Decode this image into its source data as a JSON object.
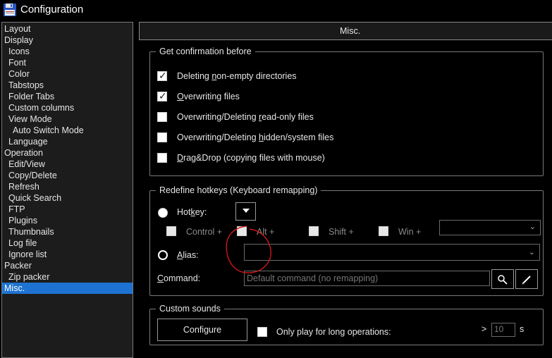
{
  "window": {
    "title": "Configuration",
    "icon": "floppy-disk-icon"
  },
  "sidebar": {
    "items": [
      {
        "label": "Layout",
        "indent": 0
      },
      {
        "label": "Display",
        "indent": 0
      },
      {
        "label": "Icons",
        "indent": 1
      },
      {
        "label": "Font",
        "indent": 1
      },
      {
        "label": "Color",
        "indent": 1
      },
      {
        "label": "Tabstops",
        "indent": 1
      },
      {
        "label": "Folder Tabs",
        "indent": 1
      },
      {
        "label": "Custom columns",
        "indent": 1
      },
      {
        "label": "View Mode",
        "indent": 1
      },
      {
        "label": "Auto Switch Mode",
        "indent": 2
      },
      {
        "label": "Language",
        "indent": 1
      },
      {
        "label": "Operation",
        "indent": 0
      },
      {
        "label": "Edit/View",
        "indent": 1
      },
      {
        "label": "Copy/Delete",
        "indent": 1
      },
      {
        "label": "Refresh",
        "indent": 1
      },
      {
        "label": "Quick Search",
        "indent": 1
      },
      {
        "label": "FTP",
        "indent": 1
      },
      {
        "label": "Plugins",
        "indent": 1
      },
      {
        "label": "Thumbnails",
        "indent": 1
      },
      {
        "label": "Log file",
        "indent": 1
      },
      {
        "label": "Ignore list",
        "indent": 1
      },
      {
        "label": "Packer",
        "indent": 0
      },
      {
        "label": "Zip packer",
        "indent": 1
      },
      {
        "label": "Misc.",
        "indent": 0,
        "selected": true
      }
    ]
  },
  "panel": {
    "title": "Misc."
  },
  "confirm": {
    "legend": "Get confirmation before",
    "items": [
      {
        "pre": "Deleting ",
        "u": "n",
        "post": "on-empty directories",
        "checked": true
      },
      {
        "pre": "",
        "u": "O",
        "post": "verwriting files",
        "checked": true
      },
      {
        "pre": "Overwriting/Deleting ",
        "u": "r",
        "post": "ead-only files",
        "checked": false
      },
      {
        "pre": "Overwriting/Deleting ",
        "u": "h",
        "post": "idden/system files",
        "checked": false
      },
      {
        "pre": "",
        "u": "D",
        "post": "rag&Drop (copying files with mouse)",
        "checked": false
      }
    ]
  },
  "hotkeys": {
    "legend": "Redefine hotkeys (Keyboard remapping)",
    "hotkey": {
      "pre": "Hot",
      "u": "k",
      "post": "ey:",
      "selected": true
    },
    "modifiers": [
      {
        "label": "Control +"
      },
      {
        "label": "Alt +"
      },
      {
        "label": "Shift +"
      },
      {
        "label": "Win +"
      }
    ],
    "alias": {
      "u": "A",
      "post": "lias:",
      "selected": false
    },
    "command": {
      "u": "C",
      "post": "ommand:",
      "placeholder": "Default command (no remapping)"
    }
  },
  "sounds": {
    "legend": "Custom sounds",
    "configure_label": "Configure",
    "long_ops_label": "Only play for long operations:",
    "threshold_prefix": ">",
    "threshold_value": "10",
    "unit": "s"
  },
  "colors": {
    "selection": "#1e73d2",
    "annotation": "#d01818"
  }
}
